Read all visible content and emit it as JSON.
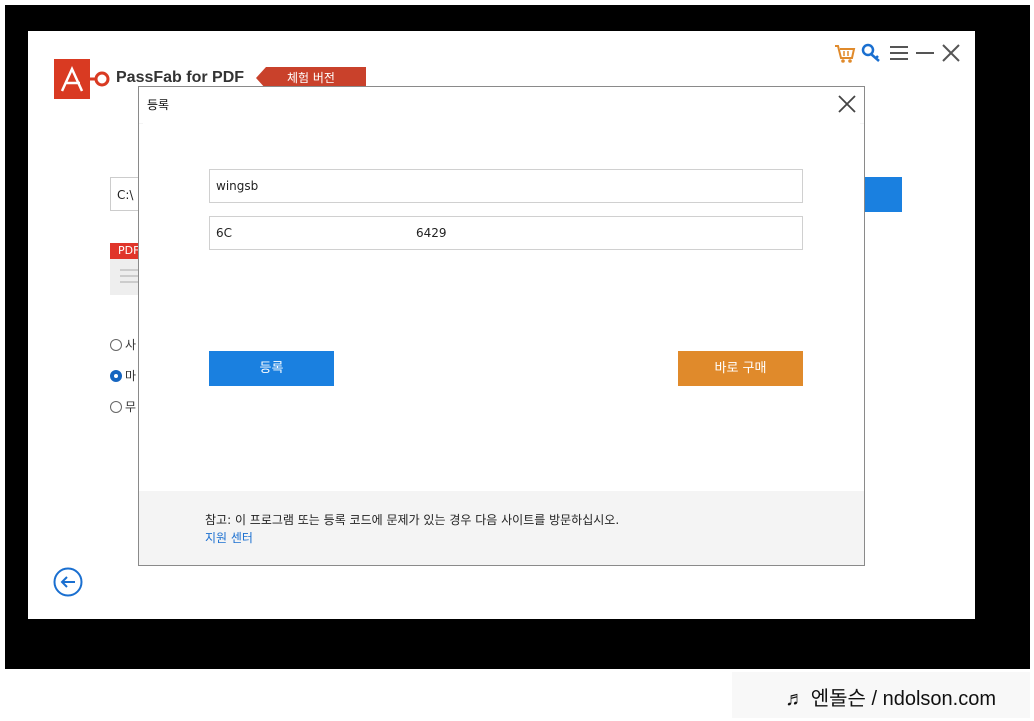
{
  "app": {
    "title": "PassFab for PDF",
    "trial_badge": "체험 버전",
    "path_value": "C:\\",
    "pdf_label": "PDF",
    "radio_options": [
      "사",
      "마",
      "무"
    ],
    "selected_radio": 1
  },
  "dialog": {
    "title": "등록",
    "email_value": "wingsb",
    "code_part1": "6C",
    "code_part2": "6429",
    "register_label": "등록",
    "buy_label": "바로 구매",
    "note": "참고: 이 프로그램 또는 등록 코드에 문제가 있는 경우 다음 사이트를 방문하십시오.",
    "support_link": "지원 센터"
  },
  "watermark": "♬ 엔돌슨 / ndolson.com",
  "icons": [
    "cart-icon",
    "key-icon",
    "menu-icon",
    "minimize-icon",
    "close-icon",
    "back-arrow-icon"
  ],
  "colors": {
    "accent_blue": "#1a80e0",
    "buy_orange": "#e08a2b",
    "brand_red": "#c9412b"
  }
}
